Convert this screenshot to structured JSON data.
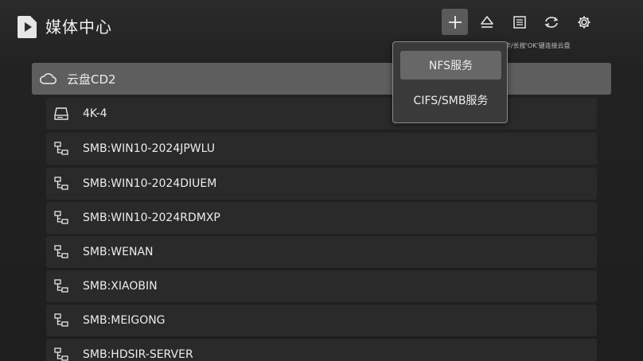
{
  "header": {
    "title": "媒体中心",
    "hint": "切换操作/长按'OK'键连接云盘"
  },
  "toolbar": {
    "buttons": [
      {
        "icon": "plus-icon",
        "active": true
      },
      {
        "icon": "eject-icon",
        "active": false
      },
      {
        "icon": "list-icon",
        "active": false
      },
      {
        "icon": "refresh-icon",
        "active": false
      },
      {
        "icon": "gear-icon",
        "active": false
      }
    ]
  },
  "popup": {
    "items": [
      {
        "label": "NFS服务",
        "active": true
      },
      {
        "label": "CIFS/SMB服务",
        "active": false
      }
    ]
  },
  "list": {
    "items": [
      {
        "icon": "cloud-icon",
        "label": "云盘CD2",
        "selected": true
      },
      {
        "icon": "drive-icon",
        "label": "4K-4",
        "selected": false
      },
      {
        "icon": "network-icon",
        "label": "SMB:WIN10-2024JPWLU",
        "selected": false
      },
      {
        "icon": "network-icon",
        "label": "SMB:WIN10-2024DIUEM",
        "selected": false
      },
      {
        "icon": "network-icon",
        "label": "SMB:WIN10-2024RDMXP",
        "selected": false
      },
      {
        "icon": "network-icon",
        "label": "SMB:WENAN",
        "selected": false
      },
      {
        "icon": "network-icon",
        "label": "SMB:XIAOBIN",
        "selected": false
      },
      {
        "icon": "network-icon",
        "label": "SMB:MEIGONG",
        "selected": false
      },
      {
        "icon": "network-icon",
        "label": "SMB:HDSIR-SERVER",
        "selected": false
      }
    ]
  },
  "colors": {
    "background": "#1f1f1f",
    "selected_row": "#5e5e5e",
    "row": "#2a2a2a",
    "popup_bg": "#3a3a3a",
    "popup_active": "#676767"
  }
}
